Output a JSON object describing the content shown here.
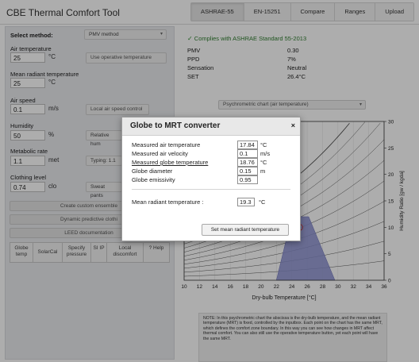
{
  "app": {
    "title": "CBE Thermal Comfort Tool",
    "tabs": [
      "ASHRAE-55",
      "EN-15251",
      "Compare",
      "Ranges",
      "Upload"
    ],
    "active_tab": "ASHRAE-55"
  },
  "left": {
    "method_label": "Select method:",
    "method_value": "PMV method",
    "air_temp": {
      "label": "Air temperature",
      "value": "25",
      "unit": "°C",
      "button": "Use operative temperature"
    },
    "mrt": {
      "label": "Mean radiant temperature",
      "value": "25",
      "unit": "°C"
    },
    "air_speed": {
      "label": "Air speed",
      "value": "0.1",
      "unit": "m/s",
      "button": "Local air speed control"
    },
    "humidity": {
      "label": "Humidity",
      "value": "50",
      "unit": "%",
      "select": "Relative hum"
    },
    "met": {
      "label": "Metabolic rate",
      "value": "1.1",
      "unit": "met",
      "select": "Typing: 1.1"
    },
    "clo": {
      "label": "Clothing level",
      "value": "0.74",
      "unit": "clo",
      "select": "Sweat pants"
    },
    "buttons": [
      "Create custom ensemble",
      "Dynamic predictive clothi",
      "LEED documentation"
    ],
    "bottom": [
      "Globe temp",
      "SolarCal",
      "Specify pressure",
      "SI IP",
      "Local discomfort",
      "? Help"
    ]
  },
  "right": {
    "comply_text": "Complies with ASHRAE Standard 55-2013",
    "results": [
      {
        "label": "PMV",
        "value": "0.30"
      },
      {
        "label": "PPD",
        "value": "7%"
      },
      {
        "label": "Sensation",
        "value": "Neutral"
      },
      {
        "label": "SET",
        "value": "26.4°C"
      }
    ],
    "chart_select": "Psychrometric chart (air temperature)",
    "note": "NOTE: In this psychrometric chart the abscissa is the dry-bulb temperature, and the mean radiant temperature (MRT) is fixed, controlled by the inputbox. Each point on the chart has the same MRT, which defines the comfort zone boundary. In this way you can see how changes in MRT affect thermal comfort. You can also still use the operative temperature button, yet each point will have the same MRT."
  },
  "chart_data": {
    "type": "area",
    "xlabel": "Dry-bulb Temperature [°C]",
    "ylabel": "Humidity Ratio [gw / kgda]",
    "x_ticks": [
      10,
      12,
      14,
      16,
      18,
      20,
      22,
      24,
      26,
      28,
      30,
      32,
      34,
      36
    ],
    "y_ticks": [
      0,
      5,
      10,
      15,
      20,
      25,
      30
    ],
    "xlim": [
      10,
      36
    ],
    "ylim": [
      0,
      30
    ],
    "comfort_zone": [
      [
        22.0,
        0
      ],
      [
        29.6,
        0
      ],
      [
        26.2,
        12.0
      ],
      [
        24.0,
        12.0
      ]
    ],
    "current_point": {
      "x": 25,
      "y": 10
    }
  },
  "modal": {
    "title": "Globe to MRT converter",
    "close": "×",
    "rows": [
      {
        "label": "Measured air temperature",
        "value": "17.84",
        "unit": "°C"
      },
      {
        "label": "Measured air velocity",
        "value": "0.1",
        "unit": "m/s"
      },
      {
        "label": "Measured globe temperature",
        "value": "18.76",
        "unit": "°C"
      },
      {
        "label": "Globe diameter",
        "value": "0.15",
        "unit": "m"
      },
      {
        "label": "Globe emissivity",
        "value": "0.95",
        "unit": ""
      }
    ],
    "result_label": "Mean radiant temperature :",
    "result_value": "19.3",
    "result_unit": "°C",
    "button": "Set mean radiant temperature"
  }
}
